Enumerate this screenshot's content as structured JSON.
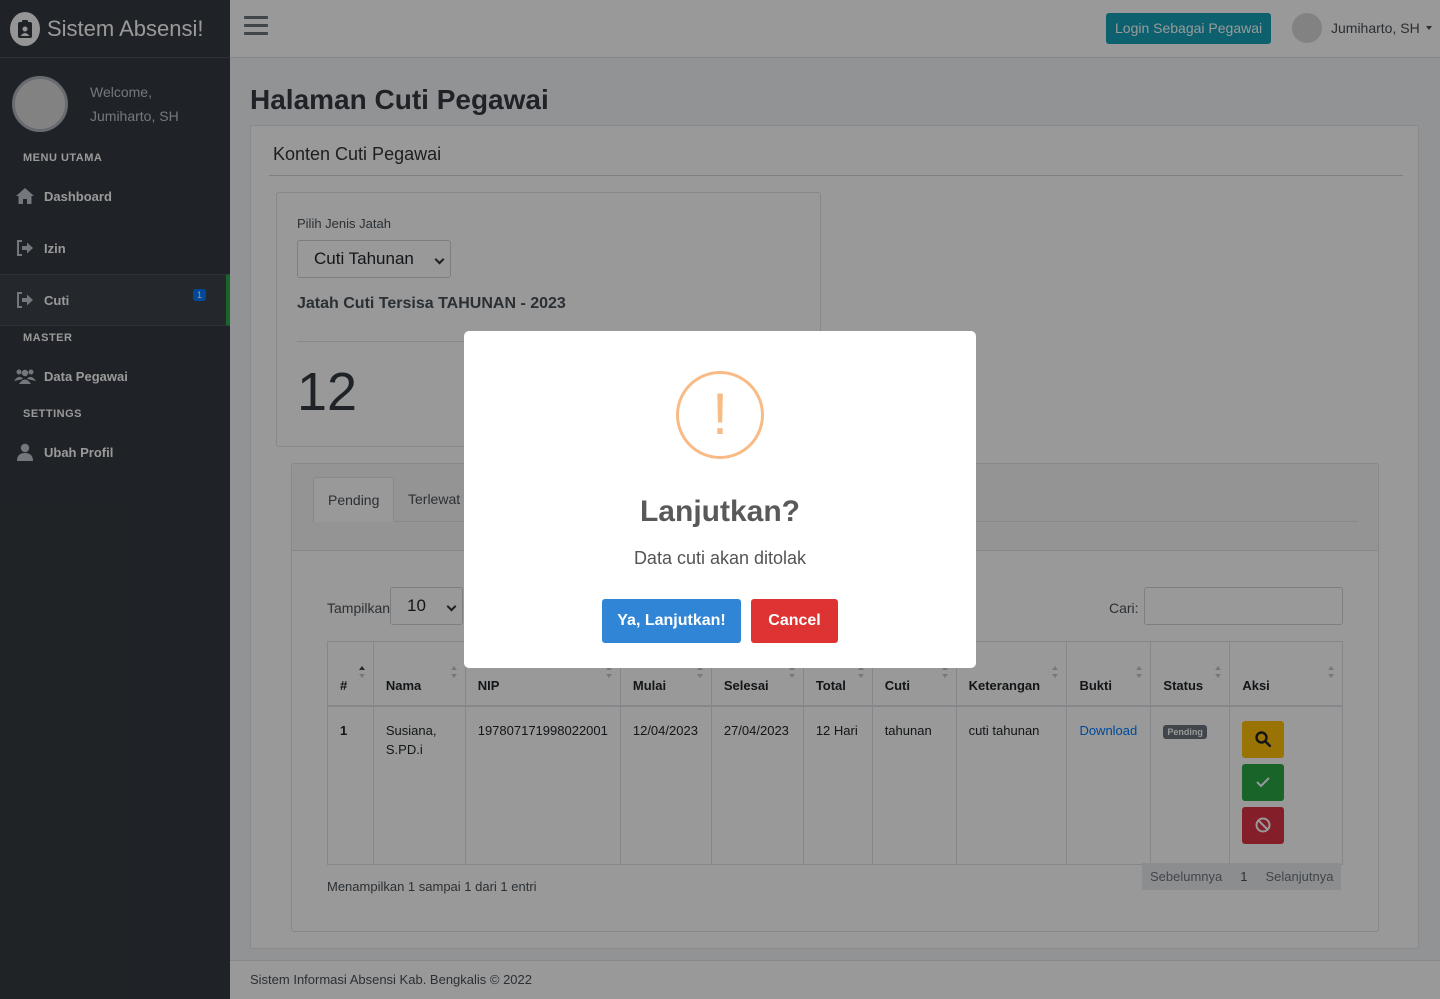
{
  "brand": {
    "title": "Sistem Absensi!"
  },
  "user_panel": {
    "welcome": "Welcome,",
    "name": "Jumiharto, SH"
  },
  "sidebar": {
    "headers": [
      "MENU UTAMA",
      "MASTER",
      "SETTINGS"
    ],
    "items": [
      {
        "label": "Dashboard",
        "icon": "home-icon"
      },
      {
        "label": "Izin",
        "icon": "sign-out-icon"
      },
      {
        "label": "Cuti",
        "icon": "sign-out-icon",
        "badge": "1"
      },
      {
        "label": "Data Pegawai",
        "icon": "users-icon"
      },
      {
        "label": "Ubah Profil",
        "icon": "user-icon"
      }
    ]
  },
  "topbar": {
    "login_button": "Login Sebagai Pegawai",
    "user_name": "Jumiharto, SH"
  },
  "page": {
    "title": "Halaman Cuti Pegawai",
    "card_title": "Konten Cuti Pegawai"
  },
  "jatah": {
    "label": "Pilih Jenis Jatah",
    "selected": "Cuti Tahunan",
    "subtitle": "Jatah Cuti Tersisa TAHUNAN - 2023",
    "remaining": "12"
  },
  "tabs": [
    "Pending",
    "Terlewat"
  ],
  "table_controls": {
    "show_label": "Tampilkan",
    "page_length": "10",
    "search_label": "Cari:"
  },
  "table": {
    "columns": [
      "#",
      "Nama",
      "NIP",
      "Mulai",
      "Selesai",
      "Total",
      "Cuti",
      "Keterangan",
      "Bukti",
      "Status",
      "Aksi"
    ],
    "rows": [
      {
        "no": "1",
        "nama": "Susiana, S.PD.i",
        "nip": "197807171998022001",
        "mulai": "12/04/2023",
        "selesai": "27/04/2023",
        "total": "12 Hari",
        "cuti": "tahunan",
        "keterangan": "cuti tahunan",
        "bukti": "Download",
        "status": "Pending"
      }
    ]
  },
  "table_info": "Menampilkan 1 sampai 1 dari 1 entri",
  "pagination": {
    "prev": "Sebelumnya",
    "current": "1",
    "next": "Selanjutnya"
  },
  "footer": "Sistem Informasi Absensi Kab. Bengkalis © 2022",
  "modal": {
    "icon": "!",
    "title": "Lanjutkan?",
    "text": "Data cuti akan ditolak",
    "confirm": "Ya, Lanjutkan!",
    "cancel": "Cancel"
  },
  "colors": {
    "sidebar": "#343a40",
    "login_button": "#17a2b8",
    "confirm": "#3085d6",
    "cancel": "#dd3333",
    "warning_icon": "#f8bb86"
  }
}
